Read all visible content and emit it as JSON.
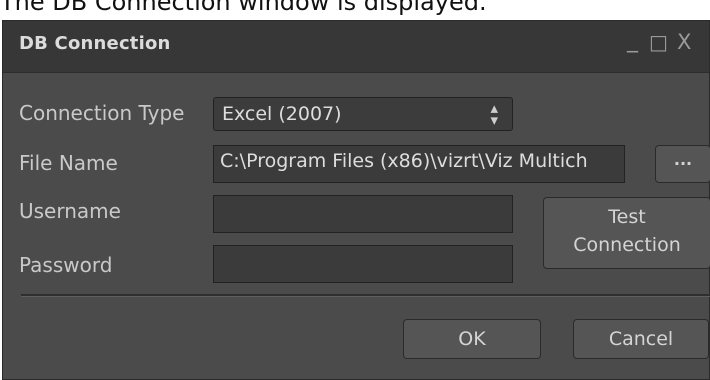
{
  "caption": "The DB Connection window is displayed.",
  "window": {
    "title": "DB Connection",
    "controls": {
      "minimize": "_",
      "maximize": "□",
      "close": "X"
    }
  },
  "form": {
    "connection_type": {
      "label": "Connection Type",
      "value": "Excel (2007)"
    },
    "file_name": {
      "label": "File Name",
      "value": "C:\\Program Files (x86)\\vizrt\\Viz Multich",
      "browse_label": "..."
    },
    "username": {
      "label": "Username",
      "value": ""
    },
    "password": {
      "label": "Password",
      "value": ""
    },
    "test_connection": {
      "line1": "Test",
      "line2": "Connection"
    }
  },
  "footer": {
    "ok_label": "OK",
    "cancel_label": "Cancel"
  }
}
